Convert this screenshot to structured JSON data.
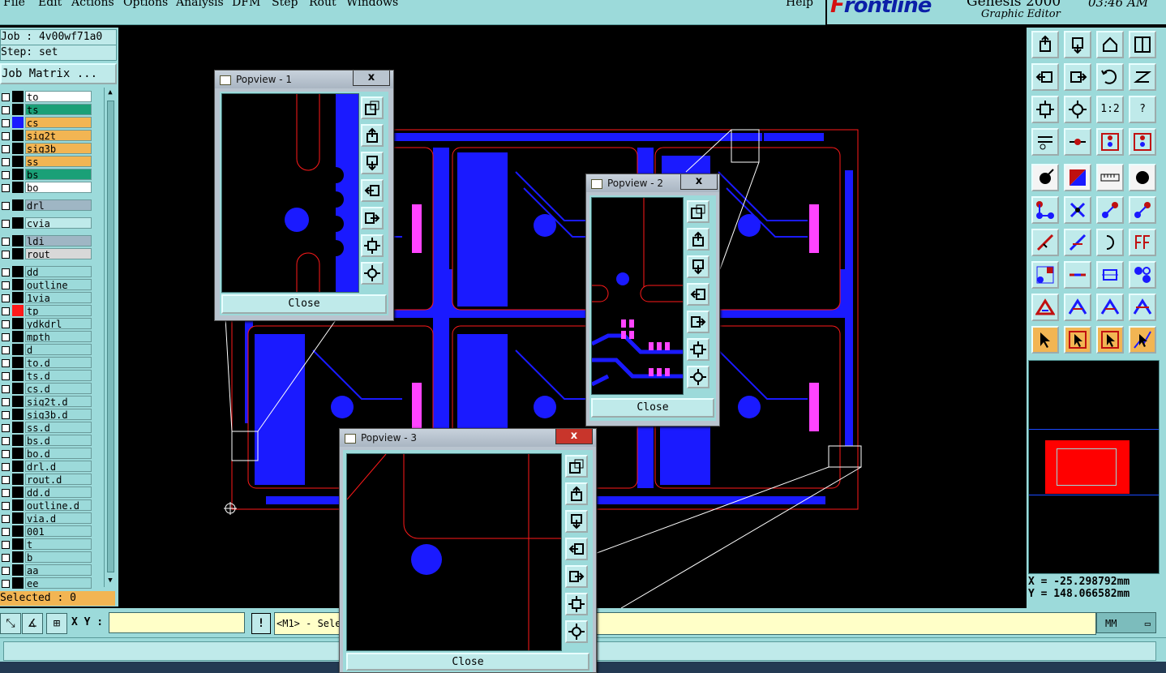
{
  "menubar": {
    "items": [
      "File",
      "Edit",
      "Actions",
      "Options",
      "Analysis",
      "DFM",
      "Step",
      "Rout",
      "Windows"
    ],
    "help": "Help"
  },
  "logo": {
    "brand_prefix": "F",
    "brand_rest": "rontline",
    "product": "Genesis 2000",
    "subtitle": "Graphic Editor",
    "clock": "03:46 AM"
  },
  "left_panel": {
    "job": "Job : 4v00wf71a0",
    "step": "Step: set",
    "job_matrix": "Job Matrix ...",
    "layers": [
      {
        "name": "to",
        "color": "#ffffff",
        "swatch": "#000000"
      },
      {
        "name": "ts",
        "color": "#1aa077",
        "swatch": "#000000"
      },
      {
        "name": "cs",
        "color": "#f2b553",
        "swatch": "#1a1aff"
      },
      {
        "name": "sig2t",
        "color": "#f2b553",
        "swatch": "#000000"
      },
      {
        "name": "sig3b",
        "color": "#f2b553",
        "swatch": "#000000"
      },
      {
        "name": "ss",
        "color": "#f2b553",
        "swatch": "#000000"
      },
      {
        "name": "bs",
        "color": "#1aa077",
        "swatch": "#000000"
      },
      {
        "name": "bo",
        "color": "#ffffff",
        "swatch": "#000000"
      },
      {
        "name": "drl",
        "color": "#9fb6c4",
        "swatch": "#000000"
      },
      {
        "name": "cvia",
        "color": "#bfeaea",
        "swatch": "#000000"
      },
      {
        "name": "ldi",
        "color": "#9fb6c4",
        "swatch": "#000000"
      },
      {
        "name": "rout",
        "color": "#d8d8d8",
        "swatch": "#000000"
      },
      {
        "name": "dd",
        "color": "#9cdada",
        "swatch": "#000000"
      },
      {
        "name": "outline",
        "color": "#9cdada",
        "swatch": "#000000"
      },
      {
        "name": "1via",
        "color": "#9cdada",
        "swatch": "#000000"
      },
      {
        "name": "tp",
        "color": "#9cdada",
        "swatch": "#ff1a1a",
        "mark": "⊞"
      },
      {
        "name": "ydkdrl",
        "color": "#9cdada",
        "swatch": "#000000"
      },
      {
        "name": "mpth",
        "color": "#9cdada",
        "swatch": "#000000"
      },
      {
        "name": "d",
        "color": "#9cdada",
        "swatch": "#000000"
      },
      {
        "name": "to.d",
        "color": "#9cdada",
        "swatch": "#000000",
        "mark": "⟋"
      },
      {
        "name": "ts.d",
        "color": "#9cdada",
        "swatch": "#000000",
        "mark": "⟋"
      },
      {
        "name": "cs.d",
        "color": "#9cdada",
        "swatch": "#000000",
        "mark": "⟋"
      },
      {
        "name": "sig2t.d",
        "color": "#9cdada",
        "swatch": "#000000",
        "mark": "⟋"
      },
      {
        "name": "sig3b.d",
        "color": "#9cdada",
        "swatch": "#000000",
        "mark": "⟋"
      },
      {
        "name": "ss.d",
        "color": "#9cdada",
        "swatch": "#000000",
        "mark": "⟋"
      },
      {
        "name": "bs.d",
        "color": "#9cdada",
        "swatch": "#000000",
        "mark": "⟋"
      },
      {
        "name": "bo.d",
        "color": "#9cdada",
        "swatch": "#000000"
      },
      {
        "name": "drl.d",
        "color": "#9cdada",
        "swatch": "#000000"
      },
      {
        "name": "rout.d",
        "color": "#9cdada",
        "swatch": "#000000"
      },
      {
        "name": "dd.d",
        "color": "#9cdada",
        "swatch": "#000000"
      },
      {
        "name": "outline.d",
        "color": "#9cdada",
        "swatch": "#000000"
      },
      {
        "name": "via.d",
        "color": "#9cdada",
        "swatch": "#000000"
      },
      {
        "name": "001",
        "color": "#9cdada",
        "swatch": "#000000"
      },
      {
        "name": "t",
        "color": "#9cdada",
        "swatch": "#000000"
      },
      {
        "name": "b",
        "color": "#9cdada",
        "swatch": "#000000"
      },
      {
        "name": "aa",
        "color": "#9cdada",
        "swatch": "#000000"
      },
      {
        "name": "ee",
        "color": "#9cdada",
        "swatch": "#000000"
      }
    ],
    "selected": "Selected : 0"
  },
  "bottom_bar": {
    "xy_label": "X Y :",
    "xy_value": "",
    "bang": "!",
    "message": "<M1> - Sele",
    "units": "MM"
  },
  "right_panel": {
    "coords": {
      "x": "X = -25.298792mm",
      "y": "Y = 148.066582mm"
    },
    "one_to_two": "1:2",
    "help_icon": "?"
  },
  "popups": [
    {
      "title": "Popview - 1",
      "close_label": "Close",
      "x_label": "x"
    },
    {
      "title": "Popview - 2",
      "close_label": "Close",
      "x_label": "x"
    },
    {
      "title": "Popview - 3",
      "close_label": "Close",
      "x_label": "x"
    }
  ],
  "colors": {
    "panel": "#9cdada",
    "copper": "#1a1aff",
    "outline": "#ff1a1a",
    "pads": "#ff44ff",
    "accent_orange": "#f2b553"
  }
}
